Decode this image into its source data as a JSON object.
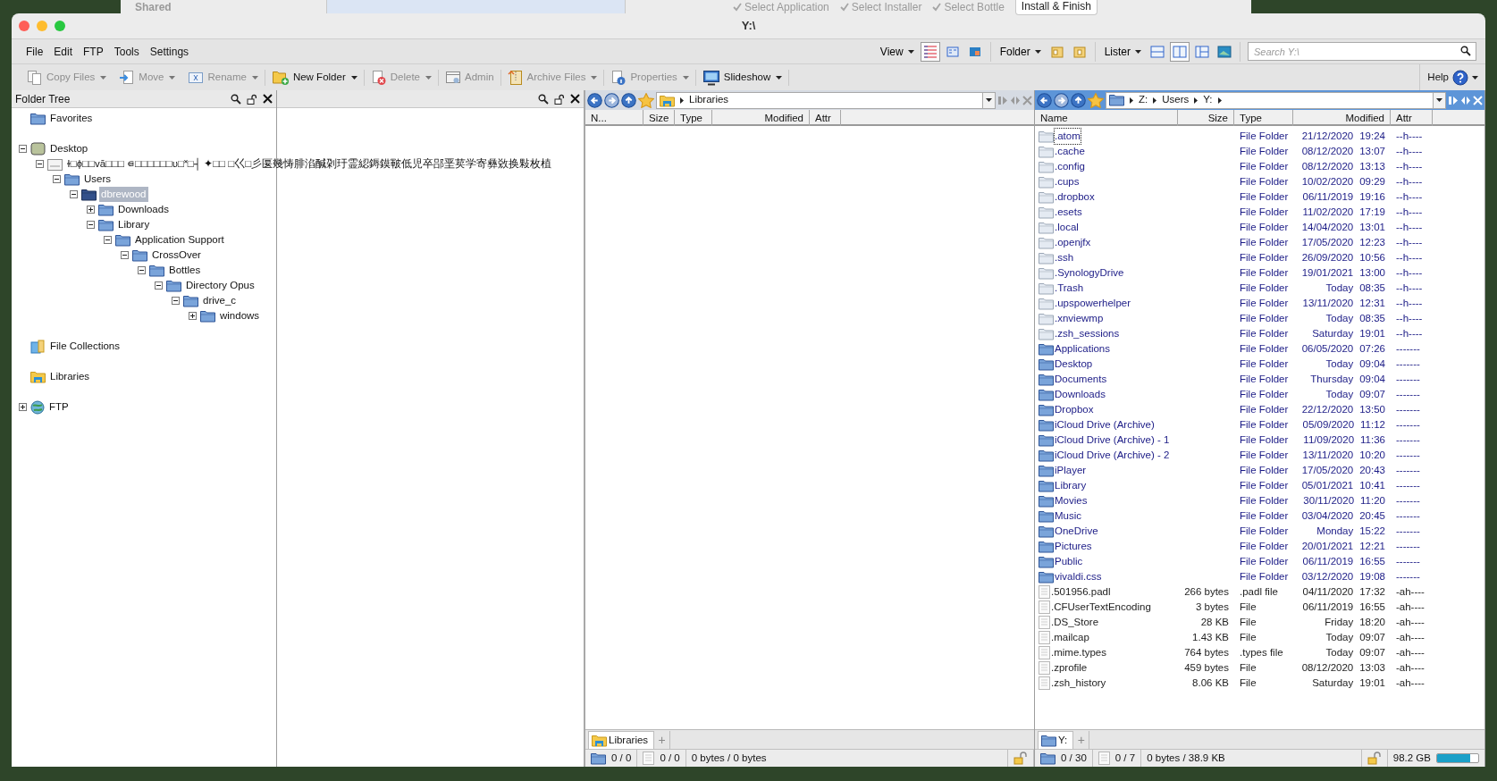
{
  "background": {
    "window_label": "Shared",
    "steps": [
      {
        "label": "Select Application",
        "done": true
      },
      {
        "label": "Select Installer",
        "done": true
      },
      {
        "label": "Select Bottle",
        "done": true
      },
      {
        "label": "Install & Finish",
        "done": false
      }
    ]
  },
  "window": {
    "title": "Y:\\"
  },
  "menu": [
    "File",
    "Edit",
    "FTP",
    "Tools",
    "Settings"
  ],
  "view_menus": [
    {
      "label": "View",
      "buttons": [
        {
          "selected": true
        },
        {
          "selected": false
        },
        {
          "selected": false
        }
      ]
    },
    {
      "label": "Folder",
      "buttons": [
        {
          "selected": false
        },
        {
          "selected": false
        }
      ]
    },
    {
      "label": "Lister",
      "buttons": [
        {
          "selected": false
        },
        {
          "selected": true
        },
        {
          "selected": false
        },
        {
          "selected": false
        }
      ]
    }
  ],
  "search": {
    "placeholder": "Search Y:\\"
  },
  "toolbar": [
    {
      "label": "Copy Files",
      "disabled": true,
      "dropdown": true
    },
    {
      "label": "Move",
      "disabled": true,
      "dropdown": true
    },
    {
      "label": "Rename",
      "disabled": true,
      "dropdown": true
    },
    {
      "label": "New Folder",
      "disabled": false,
      "dropdown": true
    },
    {
      "label": "Delete",
      "disabled": true,
      "dropdown": true
    },
    {
      "label": "Admin",
      "disabled": true,
      "dropdown": false
    },
    {
      "label": "Archive Files",
      "disabled": true,
      "dropdown": true
    },
    {
      "label": "Properties",
      "disabled": true,
      "dropdown": true
    },
    {
      "label": "Slideshow",
      "disabled": false,
      "dropdown": true
    }
  ],
  "help": {
    "label": "Help"
  },
  "folder_tree": {
    "title": "Folder Tree",
    "items": [
      {
        "label": "Favorites",
        "kind": "folder",
        "expandable": false,
        "selected": false
      },
      {
        "label": "Desktop",
        "kind": "desktop",
        "expandable": true,
        "expanded": true,
        "selected": false,
        "children": [
          {
            "label": "ɫ□ɸ□□vā□□□ ⋴□□□□□□υ□˟□┤ ✦□□ □巜□彡匽幾㤽腓淊醎刴玗霊綛鎒鏌皸低児卒郘垩荬学寄彝敚换敤枚植",
            "kind": "drive",
            "expandable": true,
            "expanded": true,
            "selected": false,
            "children": [
              {
                "label": "Users",
                "kind": "folder",
                "expandable": true,
                "expanded": true,
                "selected": false,
                "children": [
                  {
                    "label": "dbrewood",
                    "kind": "folder",
                    "expandable": true,
                    "expanded": true,
                    "selected": true,
                    "children": [
                      {
                        "label": "Downloads",
                        "kind": "folder",
                        "expandable": true,
                        "expanded": false,
                        "selected": false
                      },
                      {
                        "label": "Library",
                        "kind": "folder",
                        "expandable": true,
                        "expanded": true,
                        "selected": false,
                        "children": [
                          {
                            "label": "Application Support",
                            "kind": "folder",
                            "expandable": true,
                            "expanded": true,
                            "selected": false,
                            "children": [
                              {
                                "label": "CrossOver",
                                "kind": "folder",
                                "expandable": true,
                                "expanded": true,
                                "selected": false,
                                "children": [
                                  {
                                    "label": "Bottles",
                                    "kind": "folder",
                                    "expandable": true,
                                    "expanded": true,
                                    "selected": false,
                                    "children": [
                                      {
                                        "label": "Directory Opus",
                                        "kind": "folder",
                                        "expandable": true,
                                        "expanded": true,
                                        "selected": false,
                                        "children": [
                                          {
                                            "label": "drive_c",
                                            "kind": "folder",
                                            "expandable": true,
                                            "expanded": true,
                                            "selected": false,
                                            "children": [
                                              {
                                                "label": "windows",
                                                "kind": "folder",
                                                "expandable": true,
                                                "expanded": false,
                                                "selected": false
                                              }
                                            ]
                                          }
                                        ]
                                      }
                                    ]
                                  }
                                ]
                              }
                            ]
                          }
                        ]
                      }
                    ]
                  }
                ]
              }
            ]
          }
        ]
      },
      {
        "label": "File Collections",
        "kind": "collections",
        "expandable": false,
        "selected": false
      },
      {
        "label": "Libraries",
        "kind": "libraries",
        "expandable": false,
        "selected": false
      },
      {
        "label": "FTP",
        "kind": "ftp",
        "expandable": true,
        "expanded": false,
        "selected": false
      }
    ]
  },
  "listers": [
    {
      "active": false,
      "forward_enabled": false,
      "location": {
        "kind": "libraries"
      },
      "path": [
        "Libraries"
      ],
      "path_more": false,
      "columns": [
        "N...",
        "Size",
        "Type",
        "Modified",
        "Attr"
      ],
      "tabs": [
        {
          "label": "Libraries",
          "kind": "libraries",
          "selected": true
        }
      ],
      "add_tab": "+",
      "status": {
        "folders": "0 / 0",
        "files": "0 / 0",
        "bytes": "0 bytes / 0 bytes"
      }
    },
    {
      "active": true,
      "forward_enabled": false,
      "location": {
        "kind": "folder"
      },
      "path": [
        "Z:",
        "Users",
        "Y:"
      ],
      "path_more": true,
      "columns": [
        "Name",
        "Size",
        "Type",
        "Modified",
        "Attr"
      ],
      "rows": [
        {
          "kind": "hidden_folder",
          "name": ".atom",
          "type": "File Folder",
          "date": "21/12/2020",
          "time": "19:24",
          "attr": "--h----",
          "focused": true
        },
        {
          "kind": "hidden_folder",
          "name": ".cache",
          "type": "File Folder",
          "date": "08/12/2020",
          "time": "13:07",
          "attr": "--h----",
          "focused": false
        },
        {
          "kind": "hidden_folder",
          "name": ".config",
          "type": "File Folder",
          "date": "08/12/2020",
          "time": "13:13",
          "attr": "--h----",
          "focused": false
        },
        {
          "kind": "hidden_folder",
          "name": ".cups",
          "type": "File Folder",
          "date": "10/02/2020",
          "time": "09:29",
          "attr": "--h----",
          "focused": false
        },
        {
          "kind": "hidden_folder",
          "name": ".dropbox",
          "type": "File Folder",
          "date": "06/11/2019",
          "time": "19:16",
          "attr": "--h----",
          "focused": false
        },
        {
          "kind": "hidden_folder",
          "name": ".esets",
          "type": "File Folder",
          "date": "11/02/2020",
          "time": "17:19",
          "attr": "--h----",
          "focused": false
        },
        {
          "kind": "hidden_folder",
          "name": ".local",
          "type": "File Folder",
          "date": "14/04/2020",
          "time": "13:01",
          "attr": "--h----",
          "focused": false
        },
        {
          "kind": "hidden_folder",
          "name": ".openjfx",
          "type": "File Folder",
          "date": "17/05/2020",
          "time": "12:23",
          "attr": "--h----",
          "focused": false
        },
        {
          "kind": "hidden_folder",
          "name": ".ssh",
          "type": "File Folder",
          "date": "26/09/2020",
          "time": "10:56",
          "attr": "--h----",
          "focused": false
        },
        {
          "kind": "hidden_folder",
          "name": ".SynologyDrive",
          "type": "File Folder",
          "date": "19/01/2021",
          "time": "13:00",
          "attr": "--h----",
          "focused": false
        },
        {
          "kind": "hidden_folder",
          "name": ".Trash",
          "type": "File Folder",
          "date": "Today",
          "time": "08:35",
          "attr": "--h----",
          "focused": false
        },
        {
          "kind": "hidden_folder",
          "name": ".upspowerhelper",
          "type": "File Folder",
          "date": "13/11/2020",
          "time": "12:31",
          "attr": "--h----",
          "focused": false
        },
        {
          "kind": "hidden_folder",
          "name": ".xnviewmp",
          "type": "File Folder",
          "date": "Today",
          "time": "08:35",
          "attr": "--h----",
          "focused": false
        },
        {
          "kind": "hidden_folder",
          "name": ".zsh_sessions",
          "type": "File Folder",
          "date": "Saturday",
          "time": "19:01",
          "attr": "--h----",
          "focused": false
        },
        {
          "kind": "folder",
          "name": "Applications",
          "type": "File Folder",
          "date": "06/05/2020",
          "time": "07:26",
          "attr": "-------",
          "focused": false
        },
        {
          "kind": "folder",
          "name": "Desktop",
          "type": "File Folder",
          "date": "Today",
          "time": "09:04",
          "attr": "-------",
          "focused": false
        },
        {
          "kind": "folder",
          "name": "Documents",
          "type": "File Folder",
          "date": "Thursday",
          "time": "09:04",
          "attr": "-------",
          "focused": false
        },
        {
          "kind": "folder",
          "name": "Downloads",
          "type": "File Folder",
          "date": "Today",
          "time": "09:07",
          "attr": "-------",
          "focused": false
        },
        {
          "kind": "folder",
          "name": "Dropbox",
          "type": "File Folder",
          "date": "22/12/2020",
          "time": "13:50",
          "attr": "-------",
          "focused": false
        },
        {
          "kind": "folder",
          "name": "iCloud Drive (Archive)",
          "type": "File Folder",
          "date": "05/09/2020",
          "time": "11:12",
          "attr": "-------",
          "focused": false
        },
        {
          "kind": "folder",
          "name": "iCloud Drive (Archive) - 1",
          "type": "File Folder",
          "date": "11/09/2020",
          "time": "11:36",
          "attr": "-------",
          "focused": false
        },
        {
          "kind": "folder",
          "name": "iCloud Drive (Archive) - 2",
          "type": "File Folder",
          "date": "13/11/2020",
          "time": "10:20",
          "attr": "-------",
          "focused": false
        },
        {
          "kind": "folder",
          "name": "iPlayer",
          "type": "File Folder",
          "date": "17/05/2020",
          "time": "20:43",
          "attr": "-------",
          "focused": false
        },
        {
          "kind": "folder",
          "name": "Library",
          "type": "File Folder",
          "date": "05/01/2021",
          "time": "10:41",
          "attr": "-------",
          "focused": false
        },
        {
          "kind": "folder",
          "name": "Movies",
          "type": "File Folder",
          "date": "30/11/2020",
          "time": "11:20",
          "attr": "-------",
          "focused": false
        },
        {
          "kind": "folder",
          "name": "Music",
          "type": "File Folder",
          "date": "03/04/2020",
          "time": "20:45",
          "attr": "-------",
          "focused": false
        },
        {
          "kind": "folder",
          "name": "OneDrive",
          "type": "File Folder",
          "date": "Monday",
          "time": "15:22",
          "attr": "-------",
          "focused": false
        },
        {
          "kind": "folder",
          "name": "Pictures",
          "type": "File Folder",
          "date": "20/01/2021",
          "time": "12:21",
          "attr": "-------",
          "focused": false
        },
        {
          "kind": "folder",
          "name": "Public",
          "type": "File Folder",
          "date": "06/11/2019",
          "time": "16:55",
          "attr": "-------",
          "focused": false
        },
        {
          "kind": "folder",
          "name": "vivaldi.css",
          "type": "File Folder",
          "date": "03/12/2020",
          "time": "19:08",
          "attr": "-------",
          "focused": false
        },
        {
          "kind": "file",
          "name": ".501956.padl",
          "size": "266 bytes",
          "type": ".padl file",
          "date": "04/11/2020",
          "time": "17:32",
          "attr": "-ah----",
          "focused": false
        },
        {
          "kind": "file",
          "name": ".CFUserTextEncoding",
          "size": "3 bytes",
          "type": "File",
          "date": "06/11/2019",
          "time": "16:55",
          "attr": "-ah----",
          "focused": false
        },
        {
          "kind": "file",
          "name": ".DS_Store",
          "size": "28 KB",
          "type": "File",
          "date": "Friday",
          "time": "18:20",
          "attr": "-ah----",
          "focused": false
        },
        {
          "kind": "file",
          "name": ".mailcap",
          "size": "1.43 KB",
          "type": "File",
          "date": "Today",
          "time": "09:07",
          "attr": "-ah----",
          "focused": false
        },
        {
          "kind": "file",
          "name": ".mime.types",
          "size": "764 bytes",
          "type": ".types file",
          "date": "Today",
          "time": "09:07",
          "attr": "-ah----",
          "focused": false
        },
        {
          "kind": "file",
          "name": ".zprofile",
          "size": "459 bytes",
          "type": "File",
          "date": "08/12/2020",
          "time": "13:03",
          "attr": "-ah----",
          "focused": false
        },
        {
          "kind": "file",
          "name": ".zsh_history",
          "size": "8.06 KB",
          "type": "File",
          "date": "Saturday",
          "time": "19:01",
          "attr": "-ah----",
          "focused": false
        }
      ],
      "tabs": [
        {
          "label": "Y:",
          "kind": "folder",
          "selected": true
        }
      ],
      "add_tab": "+",
      "status": {
        "folders": "0 / 30",
        "files": "0 / 7",
        "bytes": "0 bytes / 38.9 KB",
        "free": "98.2 GB",
        "level": 0.8
      }
    }
  ]
}
